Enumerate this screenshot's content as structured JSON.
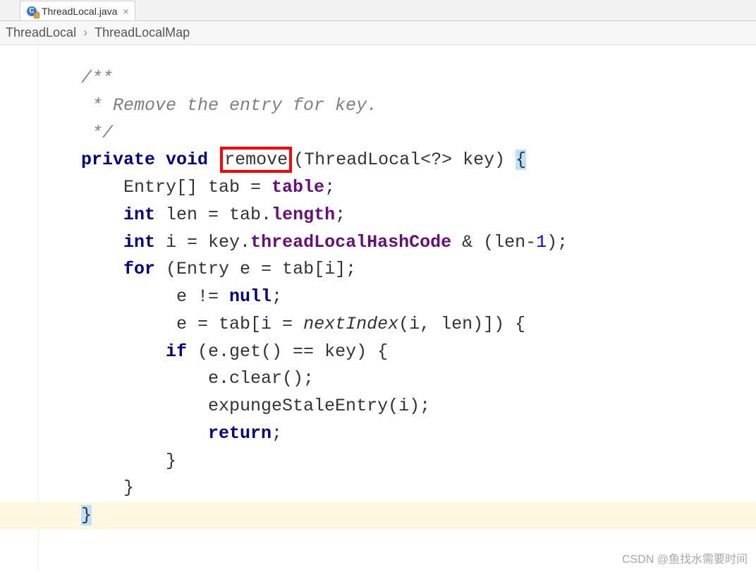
{
  "tab": {
    "filename": "ThreadLocal.java",
    "icon_letter": "C"
  },
  "breadcrumb": {
    "items": [
      "ThreadLocal",
      "ThreadLocalMap"
    ],
    "separator": "›"
  },
  "code": {
    "comment_open": "/**",
    "comment_body": " * Remove the entry for key.",
    "comment_close": " */",
    "line1_private": "private",
    "line1_void": "void",
    "line1_remove": "remove",
    "line1_params": "(ThreadLocal<?> key) ",
    "line1_brace": "{",
    "line2_a": "    Entry[] tab = ",
    "line2_table": "table",
    "line2_semi": ";",
    "line3_int": "    int",
    "line3_rest": " len = tab.",
    "line3_length": "length",
    "line3_semi": ";",
    "line4_int": "    int",
    "line4_a": " i = key.",
    "line4_field": "threadLocalHashCode",
    "line4_b": " & (len-",
    "line4_one": "1",
    "line4_c": ");",
    "line5_for": "    for",
    "line5_rest": " (Entry e = tab[i];",
    "line6": "         e != ",
    "line6_null": "null",
    "line6_semi": ";",
    "line7_a": "         e = tab[i = ",
    "line7_next": "nextIndex",
    "line7_b": "(i, len)]) {",
    "line8_if": "        if",
    "line8_rest": " (e.get() == key) {",
    "line9": "            e.clear();",
    "line10": "            expungeStaleEntry(i);",
    "line11_return": "            return",
    "line11_semi": ";",
    "line12": "        }",
    "line13": "    }",
    "line14": "}"
  },
  "watermark": "CSDN @鱼找水需要时间"
}
